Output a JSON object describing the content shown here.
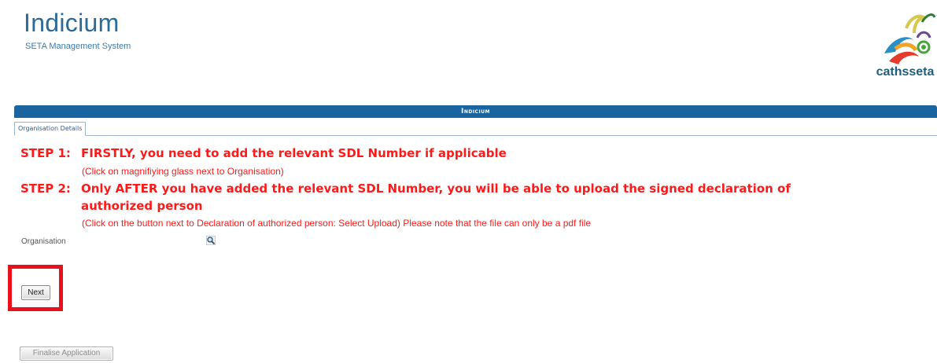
{
  "header": {
    "app_title": "Indicium",
    "app_subtitle": "SETA Management System",
    "brand_name": "cathsseta"
  },
  "titlebar": {
    "title": "Indicium"
  },
  "tabs": [
    {
      "label": "Organisation Details",
      "active": true
    }
  ],
  "steps": {
    "step1_prefix": "STEP 1:",
    "step1_text": "FIRSTLY, you need to add the relevant SDL Number if applicable",
    "step1_note": "(Click on magnifiying glass next to Organisation)",
    "step2_prefix": "STEP 2:",
    "step2_line1": "Only AFTER you have added the relevant SDL Number, you will be able to upload the signed declaration of",
    "step2_line2": "authorized person",
    "step2_note": "(Click on the button next to Declaration of authorized person: Select Upload) Please note that the file can only be a pdf file"
  },
  "form": {
    "organisation_label": "Organisation",
    "organisation_lookup_icon": "magnifying-glass-icon"
  },
  "buttons": {
    "next_label": "Next",
    "finalise_label": "Finalise Application"
  },
  "colors": {
    "accent_blue": "#1a64a0",
    "instruction_red": "#ff1a1a",
    "highlight_red": "#e8101b",
    "title_blue": "#2b6b9a"
  }
}
